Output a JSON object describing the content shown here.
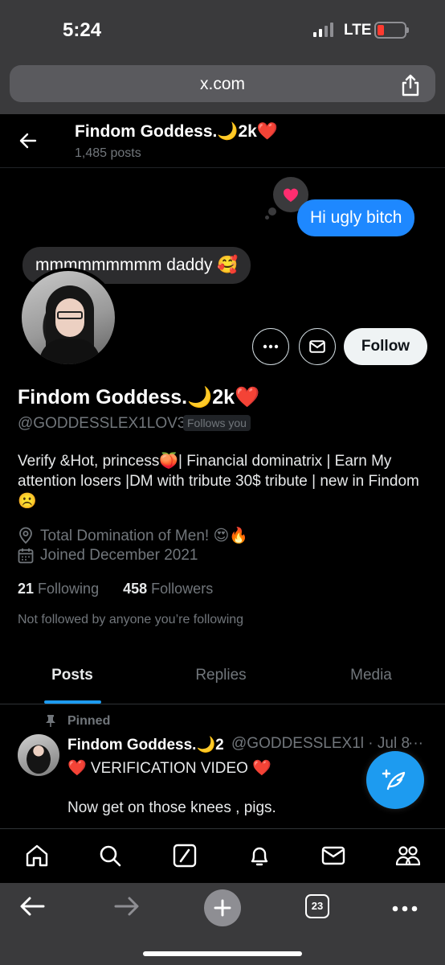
{
  "status_bar": {
    "time": "5:24",
    "network": "LTE"
  },
  "browser": {
    "url": "x.com",
    "tab_count": "23"
  },
  "header": {
    "name": "Findom Goddess.🌙2k❤️",
    "posts": "1,485 posts"
  },
  "overlay": {
    "sent_message": "Hi ugly bitch",
    "received_message": "mmmmmmmmm daddy 🥰",
    "reaction": "heart"
  },
  "profile": {
    "display_name": "Findom Goddess.🌙2k❤️",
    "handle": "@GODDESSLEX1LOV3",
    "follows_you": "Follows you",
    "follow_button": "Follow",
    "bio": "Verify &Hot, princess🍑| Financial dominatrix | Earn My attention losers |DM with tribute 30$ tribute | new in Findom☹️",
    "location": "Total Domination of Men! 😍🔥",
    "joined": "Joined December 2021",
    "following_count": "21",
    "following_label": "Following",
    "followers_count": "458",
    "followers_label": "Followers",
    "mutuals_note": "Not followed by anyone you’re following"
  },
  "tabs": [
    {
      "label": "Posts",
      "active": true
    },
    {
      "label": "Replies",
      "active": false
    },
    {
      "label": "Media",
      "active": false
    }
  ],
  "pinned_post": {
    "pinned_label": "Pinned",
    "author": "Findom Goddess.🌙2",
    "handle_date": "@GODDESSLEX1l · Jul 8",
    "more": "···",
    "line1": "❤️ VERIFICATION VIDEO ❤️",
    "line2": "Now get on those knees , pigs."
  },
  "colors": {
    "accent": "#1d9bf0",
    "imessage_blue": "#1e88ff",
    "battery_low": "#ff3b30"
  },
  "icons": {
    "bottom_nav": [
      "home-icon",
      "search-icon",
      "grok-icon",
      "notifications-icon",
      "messages-icon",
      "communities-icon"
    ],
    "browser_bar": [
      "back-arrow-icon",
      "forward-arrow-icon",
      "new-tab-plus-icon",
      "tabs-icon",
      "more-icon"
    ]
  }
}
